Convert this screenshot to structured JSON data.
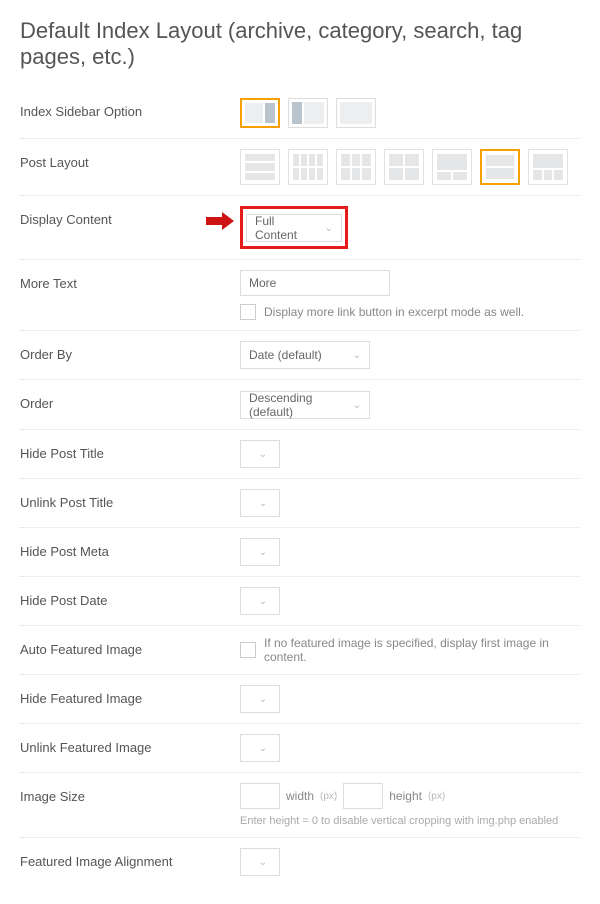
{
  "title": "Default Index Layout (archive, category, search, tag pages, etc.)",
  "labels": {
    "index_sidebar_option": "Index Sidebar Option",
    "post_layout": "Post Layout",
    "display_content": "Display Content",
    "more_text": "More Text",
    "order_by": "Order By",
    "order": "Order",
    "hide_post_title": "Hide Post Title",
    "unlink_post_title": "Unlink Post Title",
    "hide_post_meta": "Hide Post Meta",
    "hide_post_date": "Hide Post Date",
    "auto_featured_image": "Auto Featured Image",
    "hide_featured_image": "Hide Featured Image",
    "unlink_featured_image": "Unlink Featured Image",
    "image_size": "Image Size",
    "featured_image_alignment": "Featured Image Alignment"
  },
  "values": {
    "display_content": "Full Content",
    "more_text": "More",
    "more_checkbox_label": "Display more link button in excerpt mode as well.",
    "order_by": "Date (default)",
    "order": "Descending (default)",
    "auto_featured_label": "If no featured image is specified, display first image in content.",
    "image_size_note": "Enter height = 0 to disable vertical cropping with img.php enabled",
    "width_label": "width",
    "height_label": "height",
    "unit": "(px)"
  }
}
